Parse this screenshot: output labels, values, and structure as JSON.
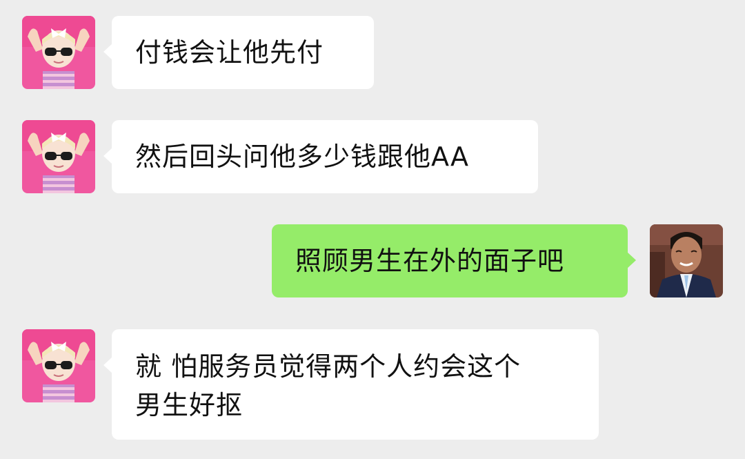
{
  "chat": {
    "messages": [
      {
        "sender": "girl",
        "side": "left",
        "text": "付钱会让他先付",
        "avatar_icon": "girl-sunglasses-avatar"
      },
      {
        "sender": "girl",
        "side": "left",
        "text": "然后回头问他多少钱跟他AA",
        "avatar_icon": "girl-sunglasses-avatar"
      },
      {
        "sender": "self",
        "side": "right",
        "text": "照顾男生在外的面子吧",
        "avatar_icon": "boy-suit-avatar"
      },
      {
        "sender": "girl",
        "side": "left",
        "text": "就 怕服务员觉得两个人约会这个\n男生好抠",
        "avatar_icon": "girl-sunglasses-avatar"
      }
    ]
  },
  "colors": {
    "background": "#ededed",
    "incoming_bubble": "#ffffff",
    "outgoing_bubble": "#95ec69",
    "text": "#111111"
  }
}
